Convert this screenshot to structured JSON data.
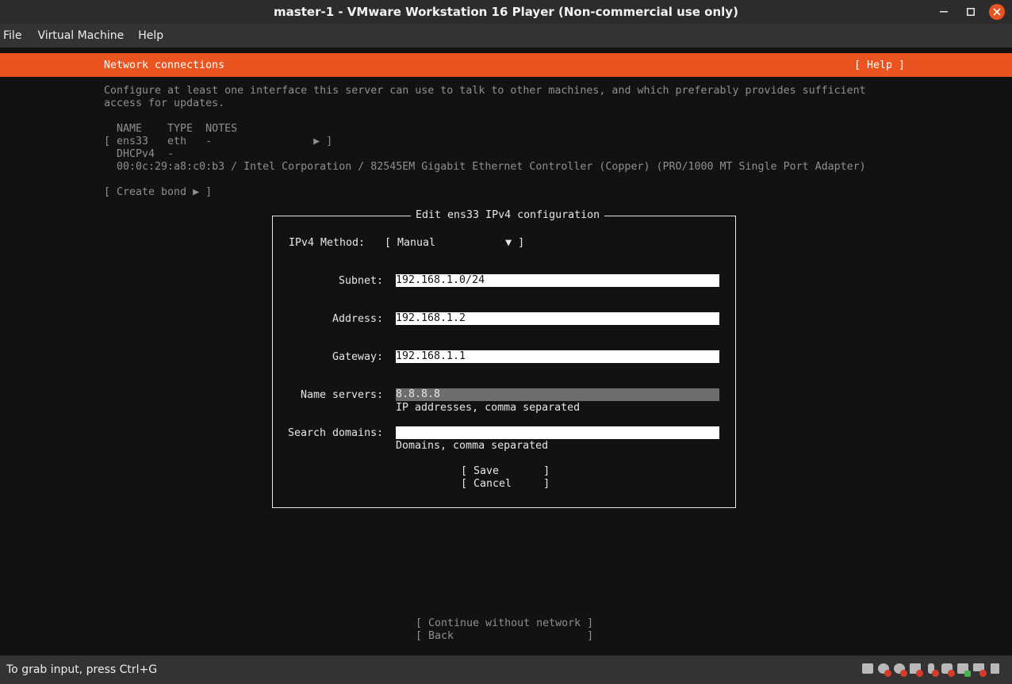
{
  "window": {
    "title": "master-1 - VMware Workstation 16 Player (Non-commercial use only)",
    "controls": [
      "minimize-icon",
      "maximize-icon",
      "close-icon"
    ]
  },
  "menu": {
    "items": [
      "File",
      "Virtual Machine",
      "Help"
    ]
  },
  "header": {
    "title": "Network connections",
    "help": "[ Help ]"
  },
  "intro": {
    "line1": "Configure at least one interface this server can use to talk to other machines, and which preferably provides sufficient",
    "line2": "access for updates."
  },
  "interfaces": {
    "header": "NAME    TYPE  NOTES",
    "row": "[ ens33   eth   -                ▶ ]",
    "dhcp": "DHCPv4  -",
    "hw": "00:0c:29:a8:c0:b3 / Intel Corporation / 82545EM Gigabit Ethernet Controller (Copper) (PRO/1000 MT Single Port Adapter)",
    "create_bond": "[ Create bond ▶ ]"
  },
  "dialog": {
    "title": "Edit ens33 IPv4 configuration",
    "method_label": "IPv4 Method:",
    "method_value": "[ Manual           ▼ ]",
    "subnet_label": "Subnet:",
    "subnet_value": "192.168.1.0/24",
    "address_label": "Address:",
    "address_value": "192.168.1.2",
    "gateway_label": "Gateway:",
    "gateway_value": "192.168.1.1",
    "ns_label": "Name servers:",
    "ns_value": "8.8.8.8",
    "ns_help": "IP addresses, comma separated",
    "sd_label": "Search domains:",
    "sd_value": "",
    "sd_help": "Domains, comma separated",
    "save": "[ Save       ]",
    "cancel": "[ Cancel     ]"
  },
  "footer": {
    "continue": "[ Continue without network ]",
    "back": "[ Back                     ]"
  },
  "statusbar": {
    "text": "To grab input, press Ctrl+G",
    "devices": [
      "hard-disk-icon",
      "cd-dvd-icon",
      "cd-dvd-icon",
      "floppy-icon",
      "usb-icon",
      "printer-icon",
      "network-icon",
      "display-icon",
      "message-icon"
    ]
  },
  "colors": {
    "accent": "#e95420",
    "console_bg": "#121212"
  }
}
